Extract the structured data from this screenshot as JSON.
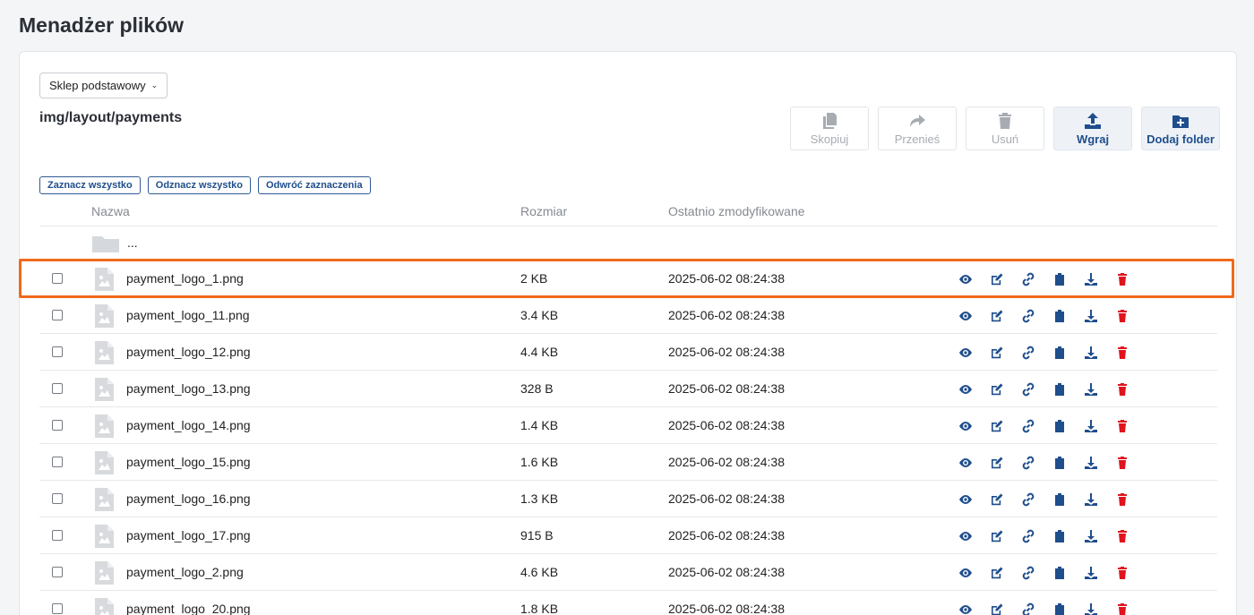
{
  "page": {
    "title": "Menadżer plików"
  },
  "shop_select": {
    "value": "Sklep podstawowy"
  },
  "path": "img/layout/payments",
  "toolbar": [
    {
      "label": "Skopiuj",
      "icon": "copy-icon",
      "state": "disabled"
    },
    {
      "label": "Przenieś",
      "icon": "move-icon",
      "state": "disabled"
    },
    {
      "label": "Usuń",
      "icon": "trash-icon",
      "state": "disabled"
    },
    {
      "label": "Wgraj",
      "icon": "upload-icon",
      "state": "active"
    },
    {
      "label": "Dodaj folder",
      "icon": "add-folder-icon",
      "state": "active"
    }
  ],
  "selection_buttons": {
    "select_all": "Zaznacz wszystko",
    "deselect_all": "Odznacz wszystko",
    "invert": "Odwróć zaznaczenia"
  },
  "table": {
    "headers": {
      "name": "Nazwa",
      "size": "Rozmiar",
      "modified": "Ostatnio zmodyfikowane"
    },
    "parent_folder": "...",
    "rows": [
      {
        "name": "payment_logo_1.png",
        "size": "2 KB",
        "modified": "2025-06-02 08:24:38",
        "highlighted": true
      },
      {
        "name": "payment_logo_11.png",
        "size": "3.4 KB",
        "modified": "2025-06-02 08:24:38"
      },
      {
        "name": "payment_logo_12.png",
        "size": "4.4 KB",
        "modified": "2025-06-02 08:24:38"
      },
      {
        "name": "payment_logo_13.png",
        "size": "328 B",
        "modified": "2025-06-02 08:24:38"
      },
      {
        "name": "payment_logo_14.png",
        "size": "1.4 KB",
        "modified": "2025-06-02 08:24:38"
      },
      {
        "name": "payment_logo_15.png",
        "size": "1.6 KB",
        "modified": "2025-06-02 08:24:38"
      },
      {
        "name": "payment_logo_16.png",
        "size": "1.3 KB",
        "modified": "2025-06-02 08:24:38"
      },
      {
        "name": "payment_logo_17.png",
        "size": "915 B",
        "modified": "2025-06-02 08:24:38"
      },
      {
        "name": "payment_logo_2.png",
        "size": "4.6 KB",
        "modified": "2025-06-02 08:24:38"
      },
      {
        "name": "payment_logo_20.png",
        "size": "1.8 KB",
        "modified": "2025-06-02 08:24:38"
      }
    ],
    "row_actions": [
      "eye-icon",
      "edit-icon",
      "link-icon",
      "clipboard-icon",
      "download-icon",
      "delete-icon"
    ]
  },
  "colors": {
    "accent": "#1f4e8c",
    "danger": "#e0141e",
    "highlight": "#ef6a1b",
    "muted": "#a7abb2"
  }
}
